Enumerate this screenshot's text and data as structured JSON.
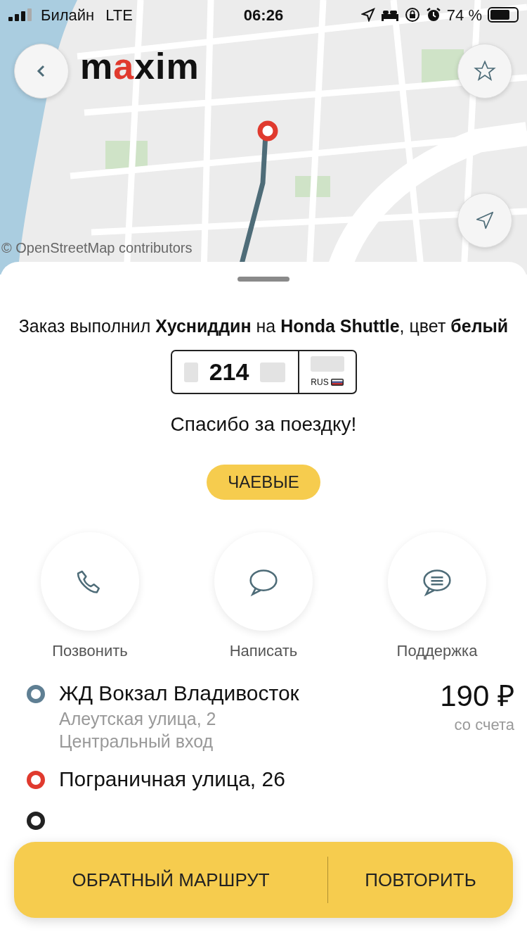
{
  "status_bar": {
    "carrier": "Билайн",
    "network": "LTE",
    "time": "06:26",
    "battery": "74 %"
  },
  "map": {
    "attribution": "© OpenStreetMap contributors"
  },
  "logo": [
    {
      "text": "m",
      "color": "#111111"
    },
    {
      "text": "a",
      "color": "#e03a2e"
    },
    {
      "text": "xim",
      "color": "#111111"
    }
  ],
  "order": {
    "summary": "Заказ выполнил **Хусниддин** на **Honda Shuttle**, цвет **белый**",
    "plate_number": "214",
    "plate_country": "RUS",
    "thanks": "Спасибо за поездку!",
    "tips_button": "ЧАЕВЫЕ"
  },
  "actions": [
    {
      "kind": "phone",
      "label": "Позвонить"
    },
    {
      "kind": "message",
      "label": "Написать"
    },
    {
      "kind": "support",
      "label": "Поддержка"
    }
  ],
  "route": [
    {
      "name": "ЖД Вокзал Владивосток",
      "details": [
        "Алеутская улица, 2",
        "Центральный вход"
      ],
      "color": "#5f7f93"
    },
    {
      "name": "Пограничная улица, 26",
      "color": "#e03a2e"
    },
    {
      "color": "#222222"
    }
  ],
  "price": {
    "amount": "190 ₽",
    "payment": "со счета"
  },
  "buttons": [
    "ОБРАТНЫЙ МАРШРУТ",
    "ПОВТОРИТЬ"
  ]
}
